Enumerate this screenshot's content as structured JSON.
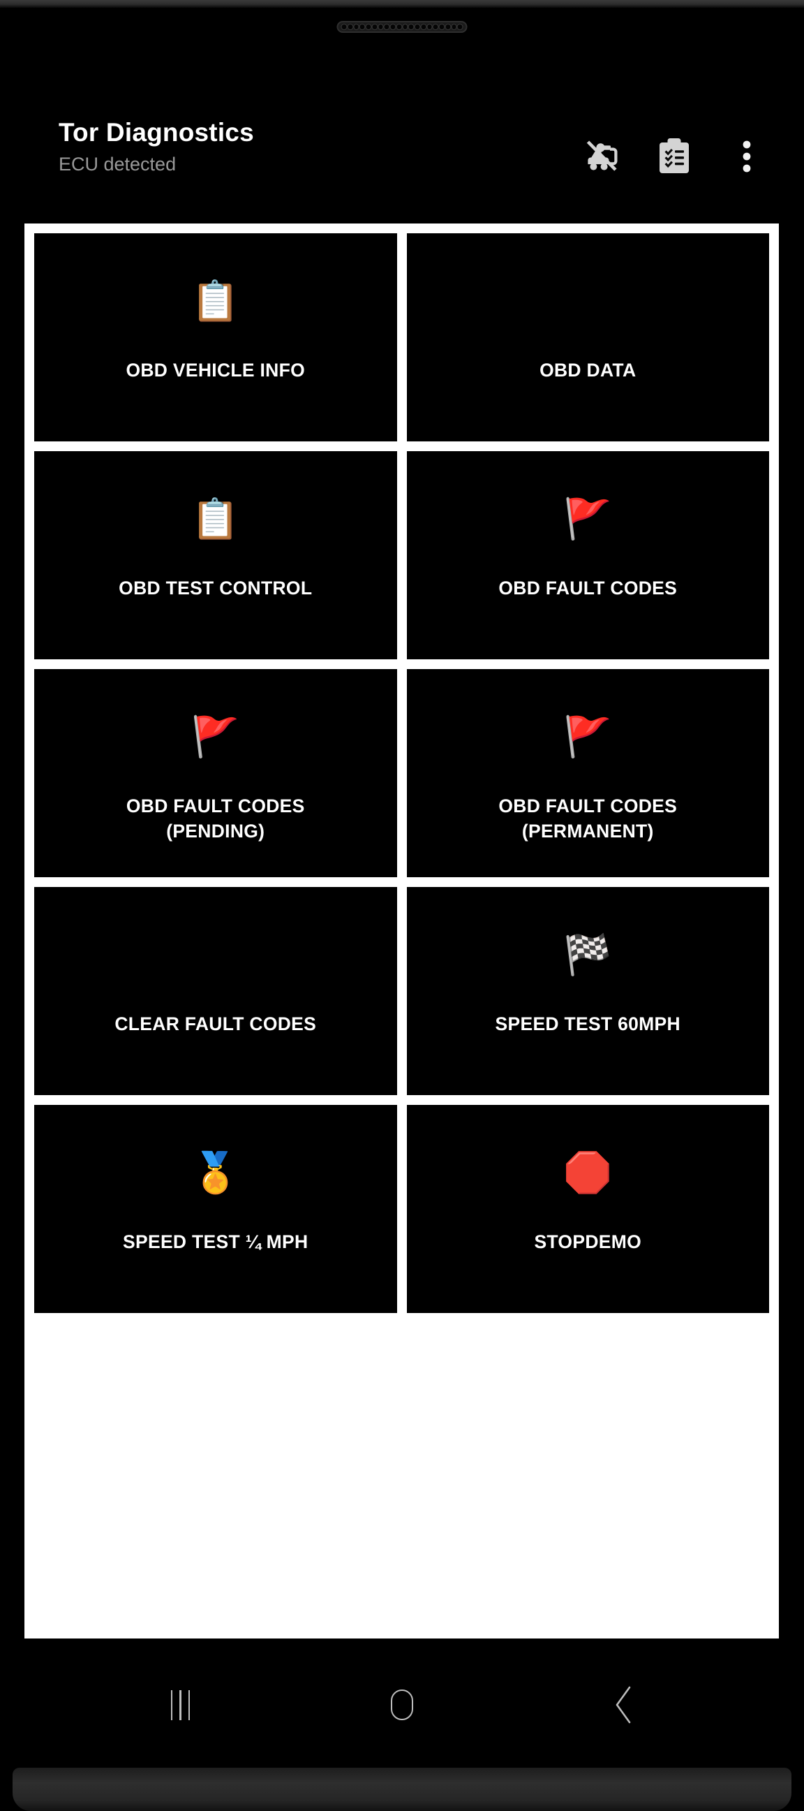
{
  "device": {
    "speaker_dots": 20
  },
  "appbar": {
    "title": "Tor Diagnostics",
    "subtitle": "ECU detected",
    "actions": [
      {
        "name": "obd-disconnect-icon",
        "label": "Disconnect OBD adapter"
      },
      {
        "name": "clipboard-checklist-icon",
        "label": "Saved reports"
      },
      {
        "name": "overflow-menu-icon",
        "label": "More options"
      }
    ]
  },
  "colors": {
    "tile_background": "#000000",
    "panel_background": "#ffffff",
    "title_text": "#ffffff",
    "subtitle_text": "#9a9a9a",
    "label_text": "#ffffff",
    "nav_icon": "#bdbdbd",
    "check_engine_yellow": "#f3c21b",
    "clear_codes_green": "#2ecc40",
    "flag_red": "#e8362b",
    "speed_badge_blue": "#3b7dd8",
    "stop_sign_red": "#c0392b"
  },
  "grid": {
    "columns": 2,
    "tiles": [
      {
        "label": "OBD VEHICLE INFO",
        "emoji": "📋",
        "icon_name": "clipboard-vehicle-icon",
        "name": "tile-obd-vehicle-info"
      },
      {
        "label": "OBD DATA",
        "emoji": "🛠",
        "icon_name": "check-engine-light-icon",
        "name": "tile-obd-data"
      },
      {
        "label": "OBD TEST CONTROL",
        "emoji": "📋",
        "icon_name": "clipboard-test-icon",
        "name": "tile-obd-test-control"
      },
      {
        "label": "OBD FAULT CODES",
        "emoji": "🚩",
        "icon_name": "person-with-flag-icon",
        "name": "tile-obd-fault-codes"
      },
      {
        "label": "OBD FAULT CODES\n(PENDING)",
        "emoji": "🚩",
        "icon_name": "person-with-flag-icon",
        "name": "tile-obd-fault-codes-pending"
      },
      {
        "label": "OBD FAULT CODES\n(PERMANENT)",
        "emoji": "🚩",
        "icon_name": "person-with-flag-icon",
        "name": "tile-obd-fault-codes-permanent"
      },
      {
        "label": "CLEAR FAULT CODES",
        "emoji": "🗑",
        "icon_name": "trash-delete-icon",
        "name": "tile-clear-fault-codes"
      },
      {
        "label": "SPEED TEST 60MPH",
        "emoji": "🏁",
        "icon_name": "racing-flag-icon",
        "name": "tile-speed-test-60mph"
      },
      {
        "label": "SPEED TEST ¼ MPH",
        "emoji": "🏅",
        "icon_name": "speed-badge-icon",
        "name": "tile-speed-test-quarter-mph"
      },
      {
        "label": "STOPDEMO",
        "emoji": "🛑",
        "icon_name": "stop-sign-icon",
        "name": "tile-stop-demo"
      }
    ]
  },
  "navbar": {
    "items": [
      {
        "name": "nav-recents-button",
        "label": "Recents"
      },
      {
        "name": "nav-home-button",
        "label": "Home"
      },
      {
        "name": "nav-back-button",
        "label": "Back"
      }
    ]
  }
}
